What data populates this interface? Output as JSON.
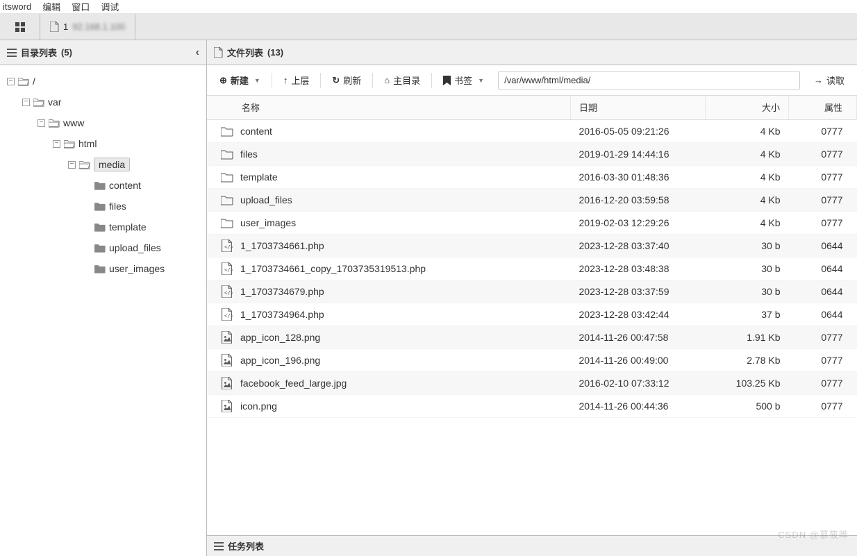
{
  "app": {
    "title": "itsword"
  },
  "menubar": [
    "编辑",
    "窗口",
    "调试"
  ],
  "tabs": {
    "open_label": "1"
  },
  "dir_panel": {
    "title": "目录列表",
    "count": "(5)",
    "tree": [
      {
        "level": 0,
        "exp": "minus",
        "type": "open",
        "label": "/"
      },
      {
        "level": 1,
        "exp": "minus",
        "type": "open",
        "label": "var"
      },
      {
        "level": 2,
        "exp": "minus",
        "type": "open",
        "label": "www"
      },
      {
        "level": 3,
        "exp": "minus",
        "type": "open",
        "label": "html"
      },
      {
        "level": 4,
        "exp": "minus",
        "type": "open",
        "label": "media",
        "selected": true
      },
      {
        "level": 5,
        "exp": "none",
        "type": "closed",
        "label": "content"
      },
      {
        "level": 5,
        "exp": "none",
        "type": "closed",
        "label": "files"
      },
      {
        "level": 5,
        "exp": "none",
        "type": "closed",
        "label": "template"
      },
      {
        "level": 5,
        "exp": "none",
        "type": "closed",
        "label": "upload_files"
      },
      {
        "level": 5,
        "exp": "none",
        "type": "closed",
        "label": "user_images"
      }
    ]
  },
  "file_panel": {
    "title": "文件列表",
    "count": "(13)"
  },
  "toolbar": {
    "new": "新建",
    "up": "上层",
    "refresh": "刷新",
    "home": "主目录",
    "bookmark": "书签",
    "path": "/var/www/html/media/",
    "read": "读取"
  },
  "columns": {
    "name": "名称",
    "date": "日期",
    "size": "大小",
    "attr": "属性"
  },
  "files": [
    {
      "icon": "folder",
      "name": "content",
      "date": "2016-05-05 09:21:26",
      "size": "4 Kb",
      "attr": "0777"
    },
    {
      "icon": "folder",
      "name": "files",
      "date": "2019-01-29 14:44:16",
      "size": "4 Kb",
      "attr": "0777"
    },
    {
      "icon": "folder",
      "name": "template",
      "date": "2016-03-30 01:48:36",
      "size": "4 Kb",
      "attr": "0777"
    },
    {
      "icon": "folder",
      "name": "upload_files",
      "date": "2016-12-20 03:59:58",
      "size": "4 Kb",
      "attr": "0777"
    },
    {
      "icon": "folder",
      "name": "user_images",
      "date": "2019-02-03 12:29:26",
      "size": "4 Kb",
      "attr": "0777"
    },
    {
      "icon": "code",
      "name": "1_1703734661.php",
      "date": "2023-12-28 03:37:40",
      "size": "30 b",
      "attr": "0644"
    },
    {
      "icon": "code",
      "name": "1_1703734661_copy_1703735319513.php",
      "date": "2023-12-28 03:48:38",
      "size": "30 b",
      "attr": "0644"
    },
    {
      "icon": "code",
      "name": "1_1703734679.php",
      "date": "2023-12-28 03:37:59",
      "size": "30 b",
      "attr": "0644"
    },
    {
      "icon": "code",
      "name": "1_1703734964.php",
      "date": "2023-12-28 03:42:44",
      "size": "37 b",
      "attr": "0644"
    },
    {
      "icon": "image",
      "name": "app_icon_128.png",
      "date": "2014-11-26 00:47:58",
      "size": "1.91 Kb",
      "attr": "0777"
    },
    {
      "icon": "image",
      "name": "app_icon_196.png",
      "date": "2014-11-26 00:49:00",
      "size": "2.78 Kb",
      "attr": "0777"
    },
    {
      "icon": "image",
      "name": "facebook_feed_large.jpg",
      "date": "2016-02-10 07:33:12",
      "size": "103.25 Kb",
      "attr": "0777"
    },
    {
      "icon": "image",
      "name": "icon.png",
      "date": "2014-11-26 00:44:36",
      "size": "500 b",
      "attr": "0777"
    }
  ],
  "task_bar": {
    "title": "任务列表"
  },
  "watermark": "CSDN @慕筱晔"
}
